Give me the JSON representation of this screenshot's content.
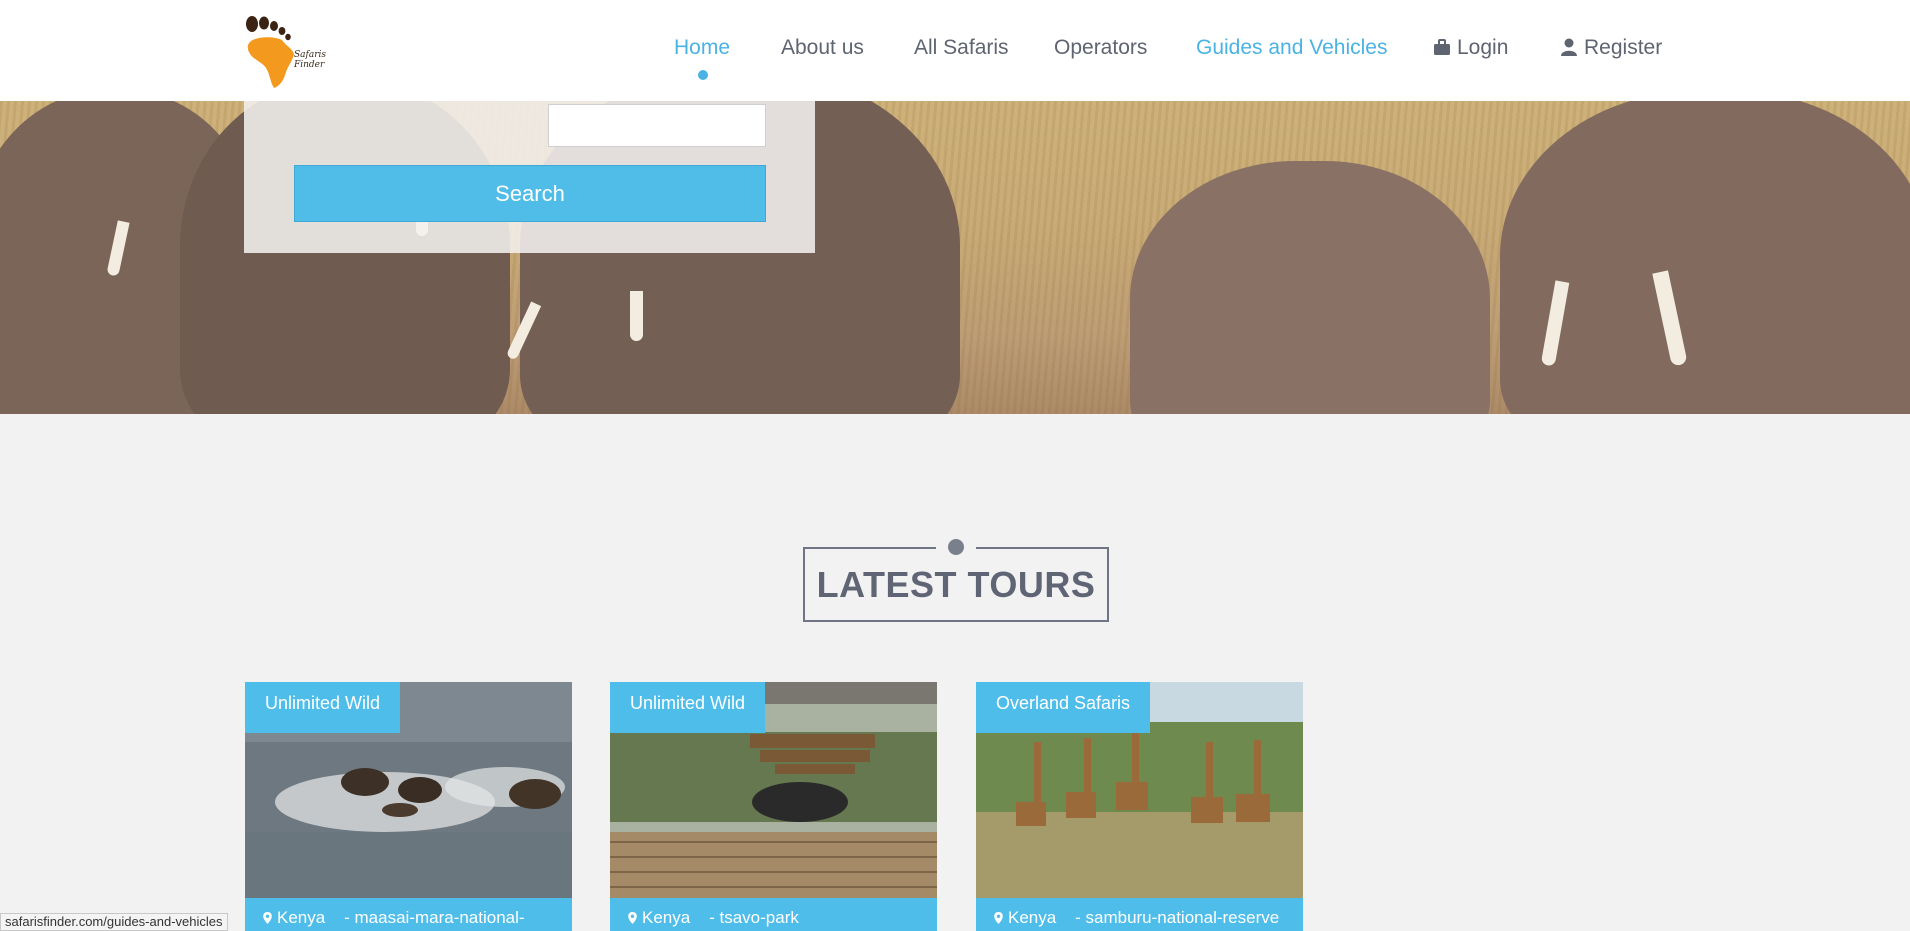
{
  "header": {
    "logo_text": "Safaris Finder",
    "nav": {
      "home": "Home",
      "about": "About us",
      "all_safaris": "All Safaris",
      "operators": "Operators",
      "guides": "Guides and Vehicles",
      "login": "Login",
      "register": "Register"
    },
    "accent_color": "#4ab3e3"
  },
  "hero": {
    "search_input_value": "",
    "search_button": "Search"
  },
  "tours": {
    "title": "LATEST TOURS",
    "cards": [
      {
        "operator": "Unlimited Wild",
        "country": "Kenya",
        "place": "- maasai-mara-national-"
      },
      {
        "operator": "Unlimited Wild",
        "country": "Kenya",
        "place": "- tsavo-park"
      },
      {
        "operator": "Overland Safaris",
        "country": "Kenya",
        "place": "- samburu-national-reserve"
      }
    ]
  },
  "status_bar": {
    "url": "safarisfinder.com/guides-and-vehicles"
  }
}
